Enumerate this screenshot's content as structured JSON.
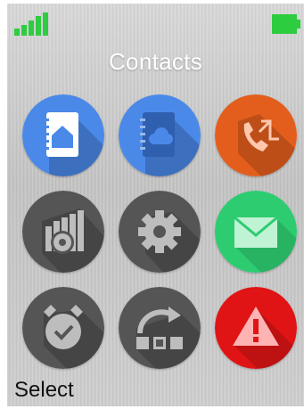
{
  "title": "Contacts",
  "softkey": {
    "left": "Select"
  },
  "colors": {
    "signal": "#2ecc40",
    "battery": "#2ecc40",
    "blue": "#4a89e8",
    "orange": "#e35e1c",
    "gray": "#555555",
    "green": "#2ecc71",
    "red": "#e01414"
  },
  "menu": [
    {
      "name": "contacts-local",
      "icon": "address-book-home-icon",
      "color": "blue"
    },
    {
      "name": "contacts-cloud",
      "icon": "address-book-cloud-icon",
      "color": "blue"
    },
    {
      "name": "call-log",
      "icon": "phone-call-arrows-icon",
      "color": "orange"
    },
    {
      "name": "system-settings",
      "icon": "chart-gear-icon",
      "color": "gray"
    },
    {
      "name": "settings",
      "icon": "gear-icon",
      "color": "gray"
    },
    {
      "name": "messages",
      "icon": "envelope-icon",
      "color": "green"
    },
    {
      "name": "alarm",
      "icon": "alarm-clock-check-icon",
      "color": "gray"
    },
    {
      "name": "sync",
      "icon": "sync-rotate-icon",
      "color": "gray"
    },
    {
      "name": "alert",
      "icon": "warning-triangle-icon",
      "color": "red"
    }
  ]
}
